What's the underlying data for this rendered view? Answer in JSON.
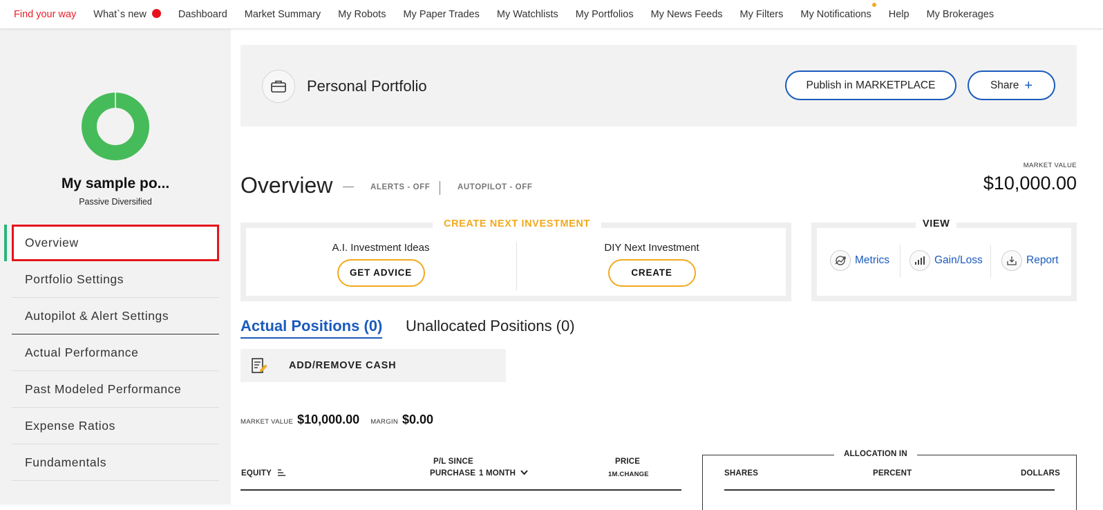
{
  "nav": {
    "items": [
      {
        "label": "Find your way",
        "active": true
      },
      {
        "label": "What`s new",
        "badge": "red-dot"
      },
      {
        "label": "Dashboard"
      },
      {
        "label": "Market Summary"
      },
      {
        "label": "My Robots"
      },
      {
        "label": "My Paper Trades"
      },
      {
        "label": "My Watchlists"
      },
      {
        "label": "My Portfolios"
      },
      {
        "label": "My News Feeds"
      },
      {
        "label": "My Filters"
      },
      {
        "label": "My Notifications",
        "badge": "orange-dot"
      },
      {
        "label": "Help"
      },
      {
        "label": "My Brokerages"
      }
    ]
  },
  "sidebar": {
    "portfolio_name": "My sample po...",
    "portfolio_type": "Passive Diversified",
    "donut_color": "#46bb5a",
    "menu": [
      {
        "label": "Overview",
        "selected": true
      },
      {
        "label": "Portfolio Settings"
      },
      {
        "label": "Autopilot & Alert Settings"
      },
      {
        "label": "Actual Performance"
      },
      {
        "label": "Past Modeled Performance"
      },
      {
        "label": "Expense Ratios"
      },
      {
        "label": "Fundamentals"
      }
    ]
  },
  "header": {
    "title": "Personal Portfolio",
    "publish_label": "Publish in MARKETPLACE",
    "share_label": "Share",
    "share_icon": "+"
  },
  "overview": {
    "title": "Overview",
    "alerts": "ALERTS - OFF",
    "autopilot": "AUTOPILOT - OFF",
    "market_value_label": "MARKET VALUE",
    "market_value": "$10,000.00"
  },
  "create_investment": {
    "title": "CREATE NEXT INVESTMENT",
    "ai_label": "A.I. Investment Ideas",
    "ai_button": "GET ADVICE",
    "diy_label": "DIY Next Investment",
    "diy_button": "CREATE"
  },
  "view": {
    "title": "VIEW",
    "metrics": "Metrics",
    "gainloss": "Gain/Loss",
    "report": "Report"
  },
  "tabs": {
    "actual": "Actual Positions (0)",
    "unallocated": "Unallocated Positions (0)"
  },
  "cash": {
    "label": "ADD/REMOVE CASH"
  },
  "values": {
    "market_value_label": "MARKET VALUE",
    "market_value": "$10,000.00",
    "margin_label": "MARGIN",
    "margin": "$0.00"
  },
  "table": {
    "equity": "EQUITY",
    "pl_line1": "P/L SINCE",
    "pl_line2": "PURCHASE",
    "period": "1 MONTH",
    "price": "PRICE",
    "price_sub": "1M.CHANGE",
    "allocation_title": "ALLOCATION IN",
    "shares": "SHARES",
    "percent": "PERCENT",
    "dollars": "DOLLARS"
  },
  "colors": {
    "accent_blue": "#1a5bbd",
    "accent_orange": "#f2a91e",
    "alert_red": "#e5141b",
    "active_green": "#2ab37a"
  }
}
